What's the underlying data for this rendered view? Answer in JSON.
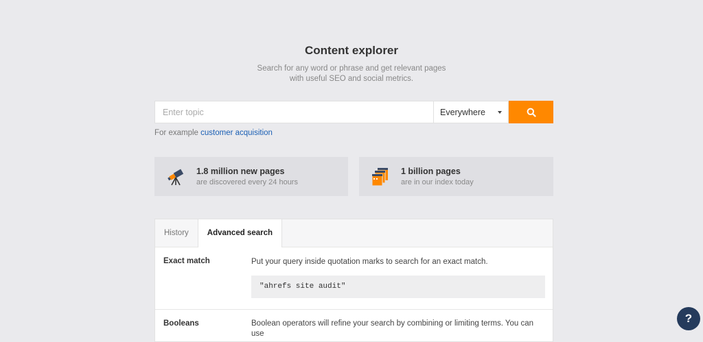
{
  "header": {
    "title": "Content explorer",
    "subtitle_line1": "Search for any word or phrase and get relevant pages",
    "subtitle_line2": "with useful SEO and social metrics."
  },
  "search": {
    "placeholder": "Enter topic",
    "value": "",
    "scope": "Everywhere",
    "example_prefix": "For example",
    "example_link": "customer acquisition"
  },
  "stats": [
    {
      "title": "1.8 million new pages",
      "subtitle": "are discovered every 24 hours",
      "icon": "telescope-icon"
    },
    {
      "title": "1 billion pages",
      "subtitle": "are in our index today",
      "icon": "pages-stack-icon"
    }
  ],
  "tabs": [
    {
      "label": "History",
      "active": false
    },
    {
      "label": "Advanced search",
      "active": true
    }
  ],
  "advanced": {
    "exact_match_label": "Exact match",
    "exact_match_desc": "Put your query inside quotation marks to search for an exact match.",
    "exact_match_example": "\"ahrefs site audit\"",
    "booleans_label": "Booleans",
    "booleans_desc": "Boolean operators will refine your search by combining or limiting terms. You can use"
  },
  "help": {
    "label": "?"
  },
  "colors": {
    "accent": "#ff8800",
    "link": "#1a5fb4",
    "help": "#253b5c"
  }
}
